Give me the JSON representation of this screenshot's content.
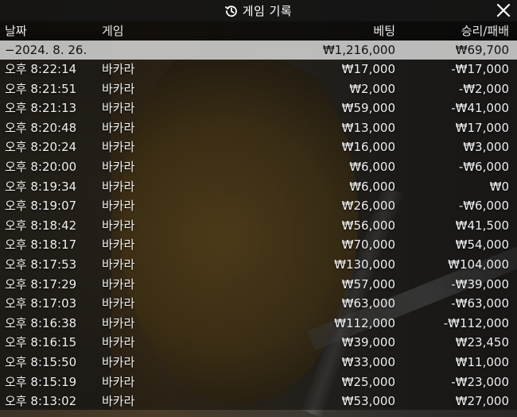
{
  "window": {
    "title": "게임 기록",
    "title_icon": "history-icon",
    "close_icon": "close-icon"
  },
  "columns": {
    "date": "날짜",
    "game": "게임",
    "bet": "베팅",
    "result": "승리/패배"
  },
  "date_group": {
    "label": "−2024. 8. 26.",
    "bet_total": "₩1,216,000",
    "result_total": "₩69,700"
  },
  "rows": [
    {
      "time": "오후 8:22:14",
      "game": "바카라",
      "bet": "₩17,000",
      "result": "-₩17,000"
    },
    {
      "time": "오후 8:21:51",
      "game": "바카라",
      "bet": "₩2,000",
      "result": "-₩2,000"
    },
    {
      "time": "오후 8:21:13",
      "game": "바카라",
      "bet": "₩59,000",
      "result": "-₩41,000"
    },
    {
      "time": "오후 8:20:48",
      "game": "바카라",
      "bet": "₩13,000",
      "result": "₩17,000"
    },
    {
      "time": "오후 8:20:24",
      "game": "바카라",
      "bet": "₩16,000",
      "result": "₩3,000"
    },
    {
      "time": "오후 8:20:00",
      "game": "바카라",
      "bet": "₩6,000",
      "result": "-₩6,000"
    },
    {
      "time": "오후 8:19:34",
      "game": "바카라",
      "bet": "₩6,000",
      "result": "₩0"
    },
    {
      "time": "오후 8:19:07",
      "game": "바카라",
      "bet": "₩26,000",
      "result": "-₩6,000"
    },
    {
      "time": "오후 8:18:42",
      "game": "바카라",
      "bet": "₩56,000",
      "result": "₩41,500"
    },
    {
      "time": "오후 8:18:17",
      "game": "바카라",
      "bet": "₩70,000",
      "result": "₩54,000"
    },
    {
      "time": "오후 8:17:53",
      "game": "바카라",
      "bet": "₩130,000",
      "result": "₩104,000"
    },
    {
      "time": "오후 8:17:29",
      "game": "바카라",
      "bet": "₩57,000",
      "result": "-₩39,000"
    },
    {
      "time": "오후 8:17:03",
      "game": "바카라",
      "bet": "₩63,000",
      "result": "-₩63,000"
    },
    {
      "time": "오후 8:16:38",
      "game": "바카라",
      "bet": "₩112,000",
      "result": "-₩112,000"
    },
    {
      "time": "오후 8:16:15",
      "game": "바카라",
      "bet": "₩39,000",
      "result": "₩23,450"
    },
    {
      "time": "오후 8:15:50",
      "game": "바카라",
      "bet": "₩33,000",
      "result": "₩11,000"
    },
    {
      "time": "오후 8:15:19",
      "game": "바카라",
      "bet": "₩25,000",
      "result": "-₩23,000"
    },
    {
      "time": "오후 8:13:02",
      "game": "바카라",
      "bet": "₩53,000",
      "result": "₩27,000"
    }
  ]
}
